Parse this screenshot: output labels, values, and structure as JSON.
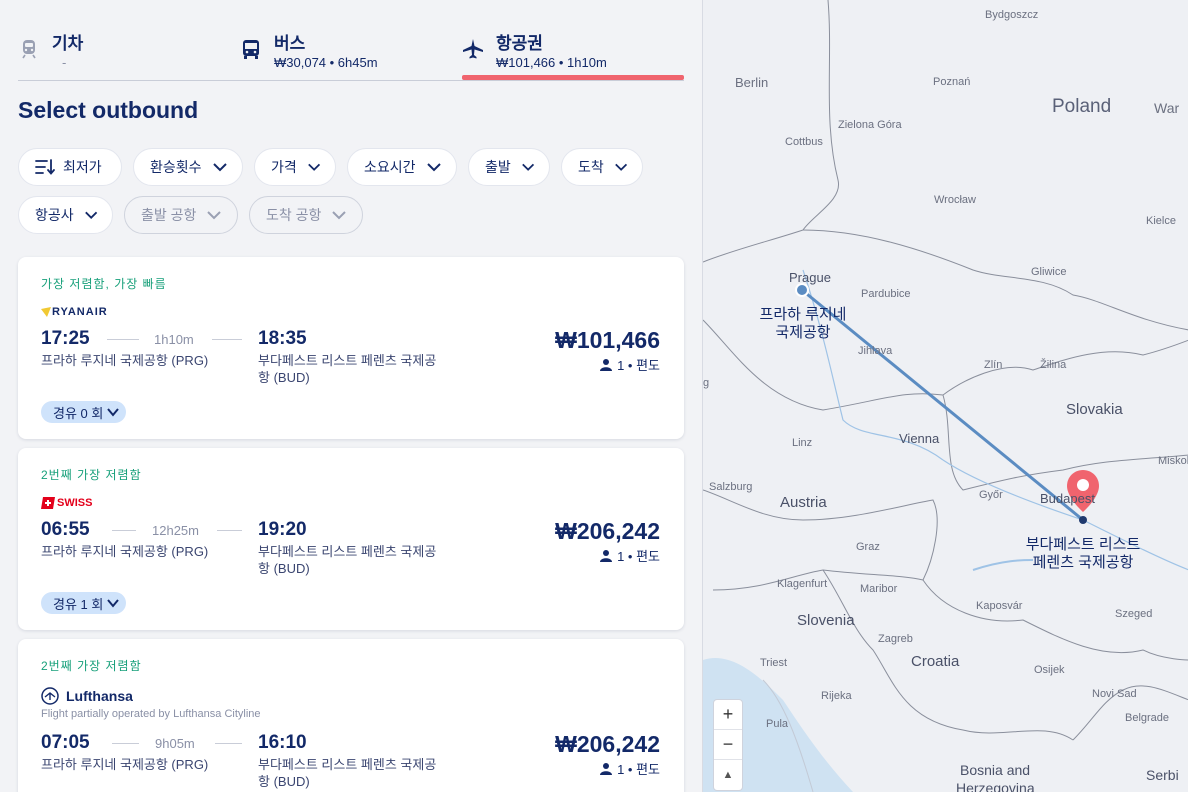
{
  "tabs": [
    {
      "title": "기차",
      "sub": "-"
    },
    {
      "title": "버스",
      "sub": "₩30,074 • 6h45m"
    },
    {
      "title": "항공권",
      "sub": "₩101,466 • 1h10m"
    }
  ],
  "heading": "Select outbound",
  "filters": {
    "sort": "최저가",
    "transfers": "환승횟수",
    "price": "가격",
    "duration": "소요시간",
    "departure": "출발",
    "arrival": "도착",
    "airline": "항공사",
    "dep_airport": "출발 공항",
    "arr_airport": "도착 공항"
  },
  "results": [
    {
      "badge": "가장 저렴함, 가장 빠름",
      "airline": "RYANAIR",
      "dep_time": "17:25",
      "duration": "1h10m",
      "arr_time": "18:35",
      "dep_place": "프라하 루지네 국제공항 (PRG)",
      "arr_place_1": "부다페스트 리스트 페렌츠 국제공",
      "arr_place_2": "항 (BUD)",
      "price": "₩101,466",
      "pax": "1 • 편도",
      "stops": "경유 0 회"
    },
    {
      "badge": "2번째 가장 저렴함",
      "airline": "SWISS",
      "dep_time": "06:55",
      "duration": "12h25m",
      "arr_time": "19:20",
      "dep_place": "프라하 루지네 국제공항 (PRG)",
      "arr_place_1": "부다페스트 리스트 페렌츠 국제공",
      "arr_place_2": "항 (BUD)",
      "price": "₩206,242",
      "pax": "1 • 편도",
      "stops": "경유 1 회"
    },
    {
      "badge": "2번째 가장 저렴함",
      "airline": "Lufthansa",
      "operated": "Flight partially operated by Lufthansa Cityline",
      "dep_time": "07:05",
      "duration": "9h05m",
      "arr_time": "16:10",
      "dep_place": "프라하 루지네 국제공항 (PRG)",
      "arr_place_1": "부다페스트 리스트 페렌츠 국제공",
      "arr_place_2": "항 (BUD)",
      "price": "₩206,242",
      "pax": "1 • 편도"
    }
  ],
  "map": {
    "origin_label_1": "프라하 루지네",
    "origin_label_2": "국제공항",
    "dest_label_1": "부다페스트 리스트",
    "dest_label_2": "페렌츠 국제공항",
    "countries": [
      "Poland",
      "Slovakia",
      "Austria",
      "Slovenia",
      "Croatia",
      "Bosnia and",
      "Herzegovina",
      "Serbi"
    ],
    "cities_major": [
      "Prague",
      "Vienna",
      "Budapest"
    ],
    "cities": [
      "Bydgoszcz",
      "Berlin",
      "Poznań",
      "War",
      "Zielona Góra",
      "Cottbus",
      "Wrocław",
      "Kielce",
      "Gliwice",
      "Pardubice",
      "Jihlava",
      "Zlín",
      "Žilina",
      "Linz",
      "Miskol",
      "Salzburg",
      "Győr",
      "Graz",
      "Klagenfurt",
      "Maribor",
      "Kaposvár",
      "Szeged",
      "Zagreb",
      "Triest",
      "Osijek",
      "Novi Sad",
      "Rijeka",
      "Pula",
      "Belgrade",
      "g"
    ],
    "zoom_in": "+",
    "zoom_out": "−",
    "compass": "▲"
  },
  "colors": {
    "accent": "#f0646e",
    "route": "#5b8cc2",
    "navy": "#132968",
    "green": "#17a07a"
  }
}
